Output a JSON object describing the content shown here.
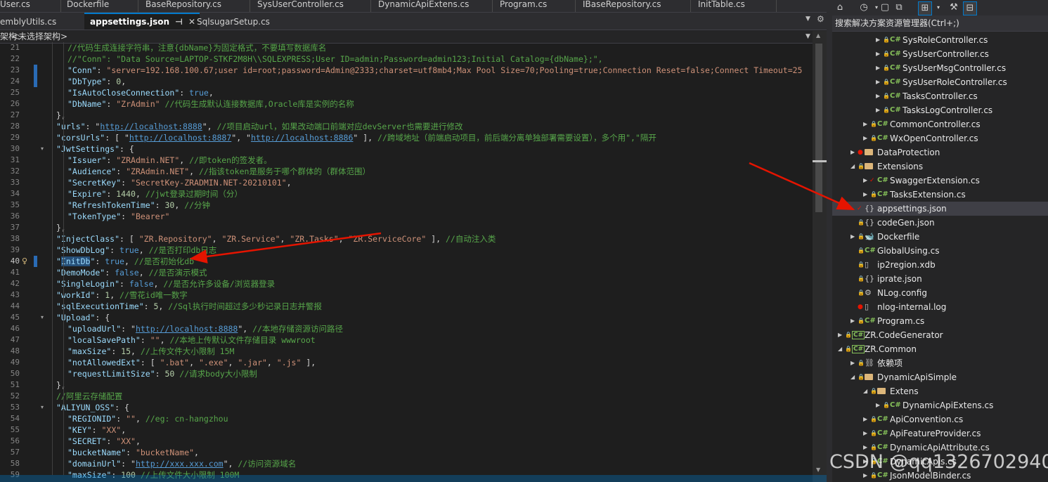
{
  "top_tabs": [
    {
      "label": "User.cs"
    },
    {
      "label": "Dockerfile"
    },
    {
      "label": "BaseRepository.cs"
    },
    {
      "label": "SysUserController.cs"
    },
    {
      "label": "DynamicApiExtens.cs"
    },
    {
      "label": "Program.cs"
    },
    {
      "label": "IBaseRepository.cs"
    },
    {
      "label": "InitTable.cs"
    }
  ],
  "second_tabs": [
    {
      "label": "emblyUtils.cs"
    },
    {
      "label": "appsettings.json",
      "active": true
    },
    {
      "label": "SqlsugarSetup.cs"
    }
  ],
  "nav_bar": {
    "label": "架构:",
    "value": "<未选择架构>"
  },
  "editor": {
    "current_line": 40,
    "changed_lines": [
      23,
      24,
      40
    ],
    "fold_lines": [
      30,
      45,
      53
    ],
    "lines": [
      {
        "n": 21,
        "indent": 2,
        "parts": [
          [
            "c",
            "//代码生成连接字符串，注意{dbName}为固定格式，不要填写数据库名"
          ]
        ]
      },
      {
        "n": 22,
        "indent": 2,
        "parts": [
          [
            "c",
            "//\"Conn\": \"Data Source=LAPTOP-STKF2M8H\\\\SQLEXPRESS;User ID=admin;Password=admin123;Initial Catalog={dbName};\","
          ]
        ]
      },
      {
        "n": 23,
        "indent": 2,
        "parts": [
          [
            "k",
            "\"Conn\""
          ],
          [
            "p",
            ": "
          ],
          [
            "s",
            "\"server=192.168.100.67;user id=root;password=Admin@2333;charset=utf8mb4;Max Pool Size=70;Pooling=true;Connection Reset=false;Connect Timeout=25"
          ]
        ]
      },
      {
        "n": 24,
        "indent": 2,
        "parts": [
          [
            "k",
            "\"DbType\""
          ],
          [
            "p",
            ": "
          ],
          [
            "n",
            "0"
          ],
          [
            "p",
            ","
          ]
        ]
      },
      {
        "n": 25,
        "indent": 2,
        "parts": [
          [
            "k",
            "\"IsAutoCloseConnection\""
          ],
          [
            "p",
            ": "
          ],
          [
            "b",
            "true"
          ],
          [
            "p",
            ","
          ]
        ]
      },
      {
        "n": 26,
        "indent": 2,
        "parts": [
          [
            "k",
            "\"DbName\""
          ],
          [
            "p",
            ": "
          ],
          [
            "s",
            "\"ZrAdmin\""
          ],
          [
            "p",
            " "
          ],
          [
            "c",
            "//代码生成默认连接数据库,Oracle库是实例的名称"
          ]
        ]
      },
      {
        "n": 27,
        "indent": 1,
        "parts": [
          [
            "p",
            "},"
          ]
        ]
      },
      {
        "n": 28,
        "indent": 1,
        "parts": [
          [
            "k",
            "\"urls\""
          ],
          [
            "p",
            ": \""
          ],
          [
            "u",
            "http://localhost:8888"
          ],
          [
            "p",
            "\", "
          ],
          [
            "c",
            "//项目启动url，如果改动端口前端对应devServer也需要进行修改"
          ]
        ]
      },
      {
        "n": 29,
        "indent": 1,
        "parts": [
          [
            "k",
            "\"corsUrls\""
          ],
          [
            "p",
            ": [ \""
          ],
          [
            "u",
            "http://localhost:8887"
          ],
          [
            "p",
            "\", \""
          ],
          [
            "u",
            "http://localhost:8886"
          ],
          [
            "p",
            "\" ], "
          ],
          [
            "c",
            "//跨域地址（前端启动项目，前后端分离单独部署需要设置），多个用\",\"隔开"
          ]
        ]
      },
      {
        "n": 30,
        "indent": 1,
        "parts": [
          [
            "k",
            "\"JwtSettings\""
          ],
          [
            "p",
            ": {"
          ]
        ]
      },
      {
        "n": 31,
        "indent": 2,
        "parts": [
          [
            "k",
            "\"Issuer\""
          ],
          [
            "p",
            ": "
          ],
          [
            "s",
            "\"ZRAdmin.NET\""
          ],
          [
            "p",
            ", "
          ],
          [
            "c",
            "//即token的签发者。"
          ]
        ]
      },
      {
        "n": 32,
        "indent": 2,
        "parts": [
          [
            "k",
            "\"Audience\""
          ],
          [
            "p",
            ": "
          ],
          [
            "s",
            "\"ZRAdmin.NET\""
          ],
          [
            "p",
            ", "
          ],
          [
            "c",
            "//指该token是服务于哪个群体的（群体范围）"
          ]
        ]
      },
      {
        "n": 33,
        "indent": 2,
        "parts": [
          [
            "k",
            "\"SecretKey\""
          ],
          [
            "p",
            ": "
          ],
          [
            "s",
            "\"SecretKey-ZRADMIN.NET-20210101\""
          ],
          [
            "p",
            ","
          ]
        ]
      },
      {
        "n": 34,
        "indent": 2,
        "parts": [
          [
            "k",
            "\"Expire\""
          ],
          [
            "p",
            ": "
          ],
          [
            "n",
            "1440"
          ],
          [
            "p",
            ", "
          ],
          [
            "c",
            "//jwt登录过期时间（分）"
          ]
        ]
      },
      {
        "n": 35,
        "indent": 2,
        "parts": [
          [
            "k",
            "\"RefreshTokenTime\""
          ],
          [
            "p",
            ": "
          ],
          [
            "n",
            "30"
          ],
          [
            "p",
            ", "
          ],
          [
            "c",
            "//分钟"
          ]
        ]
      },
      {
        "n": 36,
        "indent": 2,
        "parts": [
          [
            "k",
            "\"TokenType\""
          ],
          [
            "p",
            ": "
          ],
          [
            "s",
            "\"Bearer\""
          ]
        ]
      },
      {
        "n": 37,
        "indent": 1,
        "parts": [
          [
            "p",
            "},"
          ]
        ]
      },
      {
        "n": 38,
        "indent": 1,
        "parts": [
          [
            "k",
            "\"InjectClass\""
          ],
          [
            "p",
            ": [ "
          ],
          [
            "s",
            "\"ZR.Repository\""
          ],
          [
            "p",
            ", "
          ],
          [
            "s",
            "\"ZR.Service\""
          ],
          [
            "p",
            ", "
          ],
          [
            "s",
            "\"ZR.Tasks\""
          ],
          [
            "p",
            ", "
          ],
          [
            "s",
            "\"ZR.ServiceCore\""
          ],
          [
            "p",
            " ], "
          ],
          [
            "c",
            "//自动注入类"
          ]
        ]
      },
      {
        "n": 39,
        "indent": 1,
        "parts": [
          [
            "k",
            "\"ShowDbLog\""
          ],
          [
            "p",
            ": "
          ],
          [
            "b",
            "true"
          ],
          [
            "p",
            ", "
          ],
          [
            "c",
            "//是否打印db日志"
          ]
        ]
      },
      {
        "n": 40,
        "indent": 1,
        "parts": [
          [
            "k",
            "\""
          ],
          [
            "hl",
            "InitDb"
          ],
          [
            "k",
            "\""
          ],
          [
            "p",
            ": "
          ],
          [
            "b",
            "true"
          ],
          [
            "p",
            ", "
          ],
          [
            "c",
            "//是否初始化db"
          ]
        ]
      },
      {
        "n": 41,
        "indent": 1,
        "parts": [
          [
            "k",
            "\"DemoMode\""
          ],
          [
            "p",
            ": "
          ],
          [
            "b",
            "false"
          ],
          [
            "p",
            ", "
          ],
          [
            "c",
            "//是否演示模式"
          ]
        ]
      },
      {
        "n": 42,
        "indent": 1,
        "parts": [
          [
            "k",
            "\"SingleLogin\""
          ],
          [
            "p",
            ": "
          ],
          [
            "b",
            "false"
          ],
          [
            "p",
            ", "
          ],
          [
            "c",
            "//是否允许多设备/浏览器登录"
          ]
        ]
      },
      {
        "n": 43,
        "indent": 1,
        "parts": [
          [
            "k",
            "\"workId\""
          ],
          [
            "p",
            ": "
          ],
          [
            "n",
            "1"
          ],
          [
            "p",
            ", "
          ],
          [
            "c",
            "//雪花id唯一数字"
          ]
        ]
      },
      {
        "n": 44,
        "indent": 1,
        "parts": [
          [
            "k",
            "\"sqlExecutionTime\""
          ],
          [
            "p",
            ": "
          ],
          [
            "n",
            "5"
          ],
          [
            "p",
            ", "
          ],
          [
            "c",
            "//Sql执行时间超过多少秒记录日志并警报"
          ]
        ]
      },
      {
        "n": 45,
        "indent": 1,
        "parts": [
          [
            "k",
            "\"Upload\""
          ],
          [
            "p",
            ": {"
          ]
        ]
      },
      {
        "n": 46,
        "indent": 2,
        "parts": [
          [
            "k",
            "\"uploadUrl\""
          ],
          [
            "p",
            ": \""
          ],
          [
            "u",
            "http://localhost:8888"
          ],
          [
            "p",
            "\", "
          ],
          [
            "c",
            "//本地存储资源访问路径"
          ]
        ]
      },
      {
        "n": 47,
        "indent": 2,
        "parts": [
          [
            "k",
            "\"localSavePath\""
          ],
          [
            "p",
            ": "
          ],
          [
            "s",
            "\"\""
          ],
          [
            "p",
            ", "
          ],
          [
            "c",
            "//本地上传默认文件存储目录 wwwroot"
          ]
        ]
      },
      {
        "n": 48,
        "indent": 2,
        "parts": [
          [
            "k",
            "\"maxSize\""
          ],
          [
            "p",
            ": "
          ],
          [
            "n",
            "15"
          ],
          [
            "p",
            ", "
          ],
          [
            "c",
            "//上传文件大小限制 15M"
          ]
        ]
      },
      {
        "n": 49,
        "indent": 2,
        "parts": [
          [
            "k",
            "\"notAllowedExt\""
          ],
          [
            "p",
            ": [ "
          ],
          [
            "s",
            "\".bat\""
          ],
          [
            "p",
            ", "
          ],
          [
            "s",
            "\".exe\""
          ],
          [
            "p",
            ", "
          ],
          [
            "s",
            "\".jar\""
          ],
          [
            "p",
            ", "
          ],
          [
            "s",
            "\".js\""
          ],
          [
            "p",
            " ],"
          ]
        ]
      },
      {
        "n": 50,
        "indent": 2,
        "parts": [
          [
            "k",
            "\"requestLimitSize\""
          ],
          [
            "p",
            ": "
          ],
          [
            "n",
            "50"
          ],
          [
            "p",
            " "
          ],
          [
            "c",
            "//请求body大小限制"
          ]
        ]
      },
      {
        "n": 51,
        "indent": 1,
        "parts": [
          [
            "p",
            "},"
          ]
        ]
      },
      {
        "n": 52,
        "indent": 1,
        "parts": [
          [
            "c",
            "//阿里云存储配置"
          ]
        ]
      },
      {
        "n": 53,
        "indent": 1,
        "parts": [
          [
            "k",
            "\"ALIYUN_OSS\""
          ],
          [
            "p",
            ": {"
          ]
        ]
      },
      {
        "n": 54,
        "indent": 2,
        "parts": [
          [
            "k",
            "\"REGIONID\""
          ],
          [
            "p",
            ": "
          ],
          [
            "s",
            "\"\""
          ],
          [
            "p",
            ", "
          ],
          [
            "c",
            "//eg: cn-hangzhou"
          ]
        ]
      },
      {
        "n": 55,
        "indent": 2,
        "parts": [
          [
            "k",
            "\"KEY\""
          ],
          [
            "p",
            ": "
          ],
          [
            "s",
            "\"XX\""
          ],
          [
            "p",
            ","
          ]
        ]
      },
      {
        "n": 56,
        "indent": 2,
        "parts": [
          [
            "k",
            "\"SECRET\""
          ],
          [
            "p",
            ": "
          ],
          [
            "s",
            "\"XX\""
          ],
          [
            "p",
            ","
          ]
        ]
      },
      {
        "n": 57,
        "indent": 2,
        "parts": [
          [
            "k",
            "\"bucketName\""
          ],
          [
            "p",
            ": "
          ],
          [
            "s",
            "\"bucketName\""
          ],
          [
            "p",
            ","
          ]
        ]
      },
      {
        "n": 58,
        "indent": 2,
        "parts": [
          [
            "k",
            "\"domainUrl\""
          ],
          [
            "p",
            ": \""
          ],
          [
            "u",
            "http://xxx.xxx.com"
          ],
          [
            "p",
            "\", "
          ],
          [
            "c",
            "//访问资源域名"
          ]
        ]
      },
      {
        "n": 59,
        "indent": 2,
        "parts": [
          [
            "k",
            "\"maxSize\""
          ],
          [
            "p",
            ": "
          ],
          [
            "n",
            "100"
          ],
          [
            "p",
            " "
          ],
          [
            "c",
            "//上传文件大小限制 100M"
          ]
        ]
      }
    ]
  },
  "solution_explorer": {
    "search_placeholder": "搜索解决方案资源管理器(Ctrl+;)",
    "items": [
      {
        "label": "SysRoleController.cs",
        "level": 4,
        "type": "cs",
        "expand": "right"
      },
      {
        "label": "SysUserController.cs",
        "level": 4,
        "type": "cs",
        "expand": "right"
      },
      {
        "label": "SysUserMsgController.cs",
        "level": 4,
        "type": "cs",
        "expand": "right"
      },
      {
        "label": "SysUserRoleController.cs",
        "level": 4,
        "type": "cs",
        "expand": "right"
      },
      {
        "label": "TasksController.cs",
        "level": 4,
        "type": "cs",
        "expand": "right"
      },
      {
        "label": "TasksLogController.cs",
        "level": 4,
        "type": "cs",
        "expand": "right"
      },
      {
        "label": "CommonController.cs",
        "level": 3,
        "type": "cs",
        "expand": "right"
      },
      {
        "label": "WxOpenController.cs",
        "level": 3,
        "type": "cs",
        "expand": "right"
      },
      {
        "label": "DataProtection",
        "level": 2,
        "type": "folder",
        "expand": "right",
        "mark": "red-dot"
      },
      {
        "label": "Extensions",
        "level": 2,
        "type": "folder",
        "expand": "down"
      },
      {
        "label": "SwaggerExtension.cs",
        "level": 3,
        "type": "cs",
        "expand": "right",
        "mark": "red-check"
      },
      {
        "label": "TasksExtension.cs",
        "level": 3,
        "type": "cs",
        "expand": "right"
      },
      {
        "label": "appsettings.json",
        "level": 2,
        "type": "json",
        "expand": "none",
        "mark": "red-check",
        "selected": true
      },
      {
        "label": "codeGen.json",
        "level": 2,
        "type": "json",
        "expand": "none"
      },
      {
        "label": "Dockerfile",
        "level": 2,
        "type": "docker",
        "expand": "right"
      },
      {
        "label": "GlobalUsing.cs",
        "level": 2,
        "type": "cs",
        "expand": "none"
      },
      {
        "label": "ip2region.xdb",
        "level": 2,
        "type": "file",
        "expand": "none"
      },
      {
        "label": "iprate.json",
        "level": 2,
        "type": "json",
        "expand": "none"
      },
      {
        "label": "NLog.config",
        "level": 2,
        "type": "config",
        "expand": "none"
      },
      {
        "label": "nlog-internal.log",
        "level": 2,
        "type": "file",
        "expand": "none",
        "mark": "red-dot"
      },
      {
        "label": "Program.cs",
        "level": 2,
        "type": "cs",
        "expand": "right"
      },
      {
        "label": "ZR.CodeGenerator",
        "level": 1,
        "type": "csproj",
        "expand": "right"
      },
      {
        "label": "ZR.Common",
        "level": 1,
        "type": "csproj",
        "expand": "down"
      },
      {
        "label": "依赖项",
        "level": 2,
        "type": "deps",
        "expand": "right"
      },
      {
        "label": "DynamicApiSimple",
        "level": 2,
        "type": "folder",
        "expand": "down"
      },
      {
        "label": "Extens",
        "level": 3,
        "type": "folder",
        "expand": "down"
      },
      {
        "label": "DynamicApiExtens.cs",
        "level": 4,
        "type": "cs",
        "expand": "right"
      },
      {
        "label": "ApiConvention.cs",
        "level": 3,
        "type": "cs",
        "expand": "right"
      },
      {
        "label": "ApiFeatureProvider.cs",
        "level": 3,
        "type": "cs",
        "expand": "right"
      },
      {
        "label": "DynamicApiAttribute.cs",
        "level": 3,
        "type": "cs",
        "expand": "right"
      },
      {
        "label": "DynamicApis.cs",
        "level": 3,
        "type": "cs",
        "expand": "right"
      },
      {
        "label": "JsonModelBinder.cs",
        "level": 3,
        "type": "cs",
        "expand": "right"
      }
    ]
  },
  "watermark": "CSDN @qq1326702940",
  "colors": {
    "accent": "#007acc",
    "annotation_arrow": "#e51400"
  }
}
